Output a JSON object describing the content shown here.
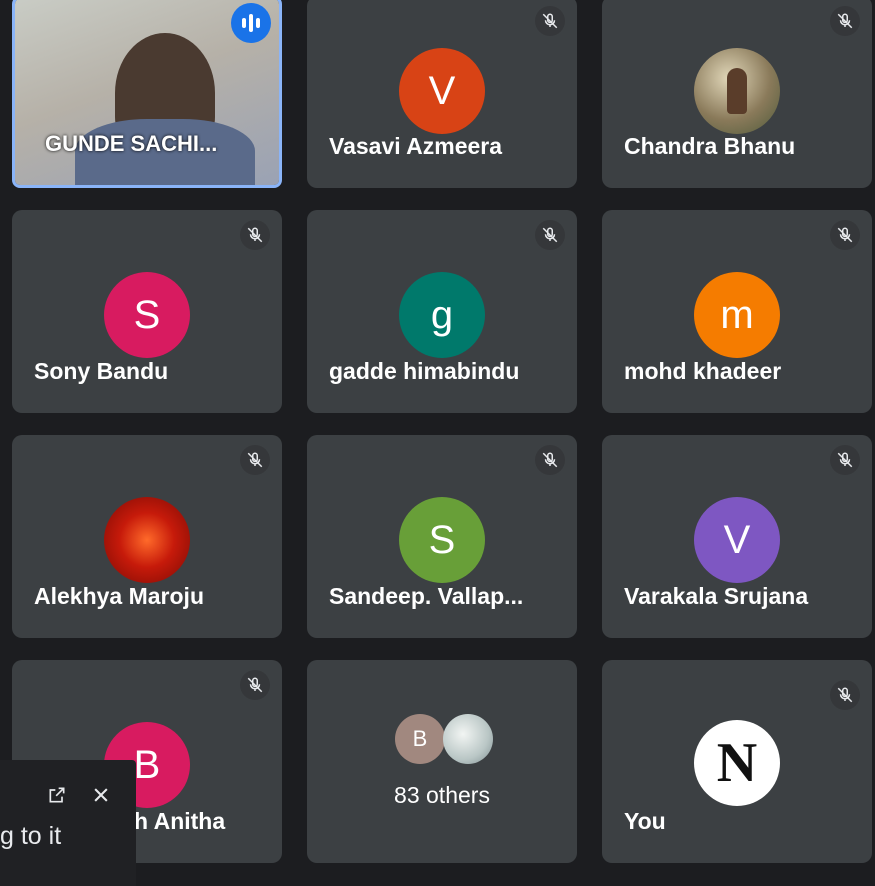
{
  "tiles": {
    "t0": {
      "name": "GUNDE SACHI...",
      "type": "video",
      "speaking": true
    },
    "t1": {
      "name": "Vasavi Azmeera",
      "initial": "V",
      "color": "#d84315"
    },
    "t2": {
      "name": "Chandra Bhanu",
      "type": "photo"
    },
    "t3": {
      "name": "Sony Bandu",
      "initial": "S",
      "color": "#d81b60"
    },
    "t4": {
      "name": "gadde himabindu",
      "initial": "g",
      "color": "#00796b"
    },
    "t5": {
      "name": "mohd khadeer",
      "initial": "m",
      "color": "#f57c00"
    },
    "t6": {
      "name": "Alekhya Maroju",
      "type": "photo"
    },
    "t7": {
      "name": "Sandeep. Vallap...",
      "initial": "S",
      "color": "#689f38"
    },
    "t8": {
      "name": "Varakala Srujana",
      "initial": "V",
      "color": "#7e57c2"
    },
    "t9": {
      "name": "h Anitha",
      "initial": "B",
      "color": "#d81b60"
    },
    "t10": {
      "label": "83 others",
      "mini_initial": "B",
      "mini_color": "#a1887f"
    },
    "t11": {
      "name": "You",
      "avatar_letter": "N"
    }
  },
  "pip": {
    "text": "g to it"
  },
  "icons": {
    "mic_off": "mic-off-icon",
    "open": "open-external-icon",
    "close": "close-icon"
  }
}
